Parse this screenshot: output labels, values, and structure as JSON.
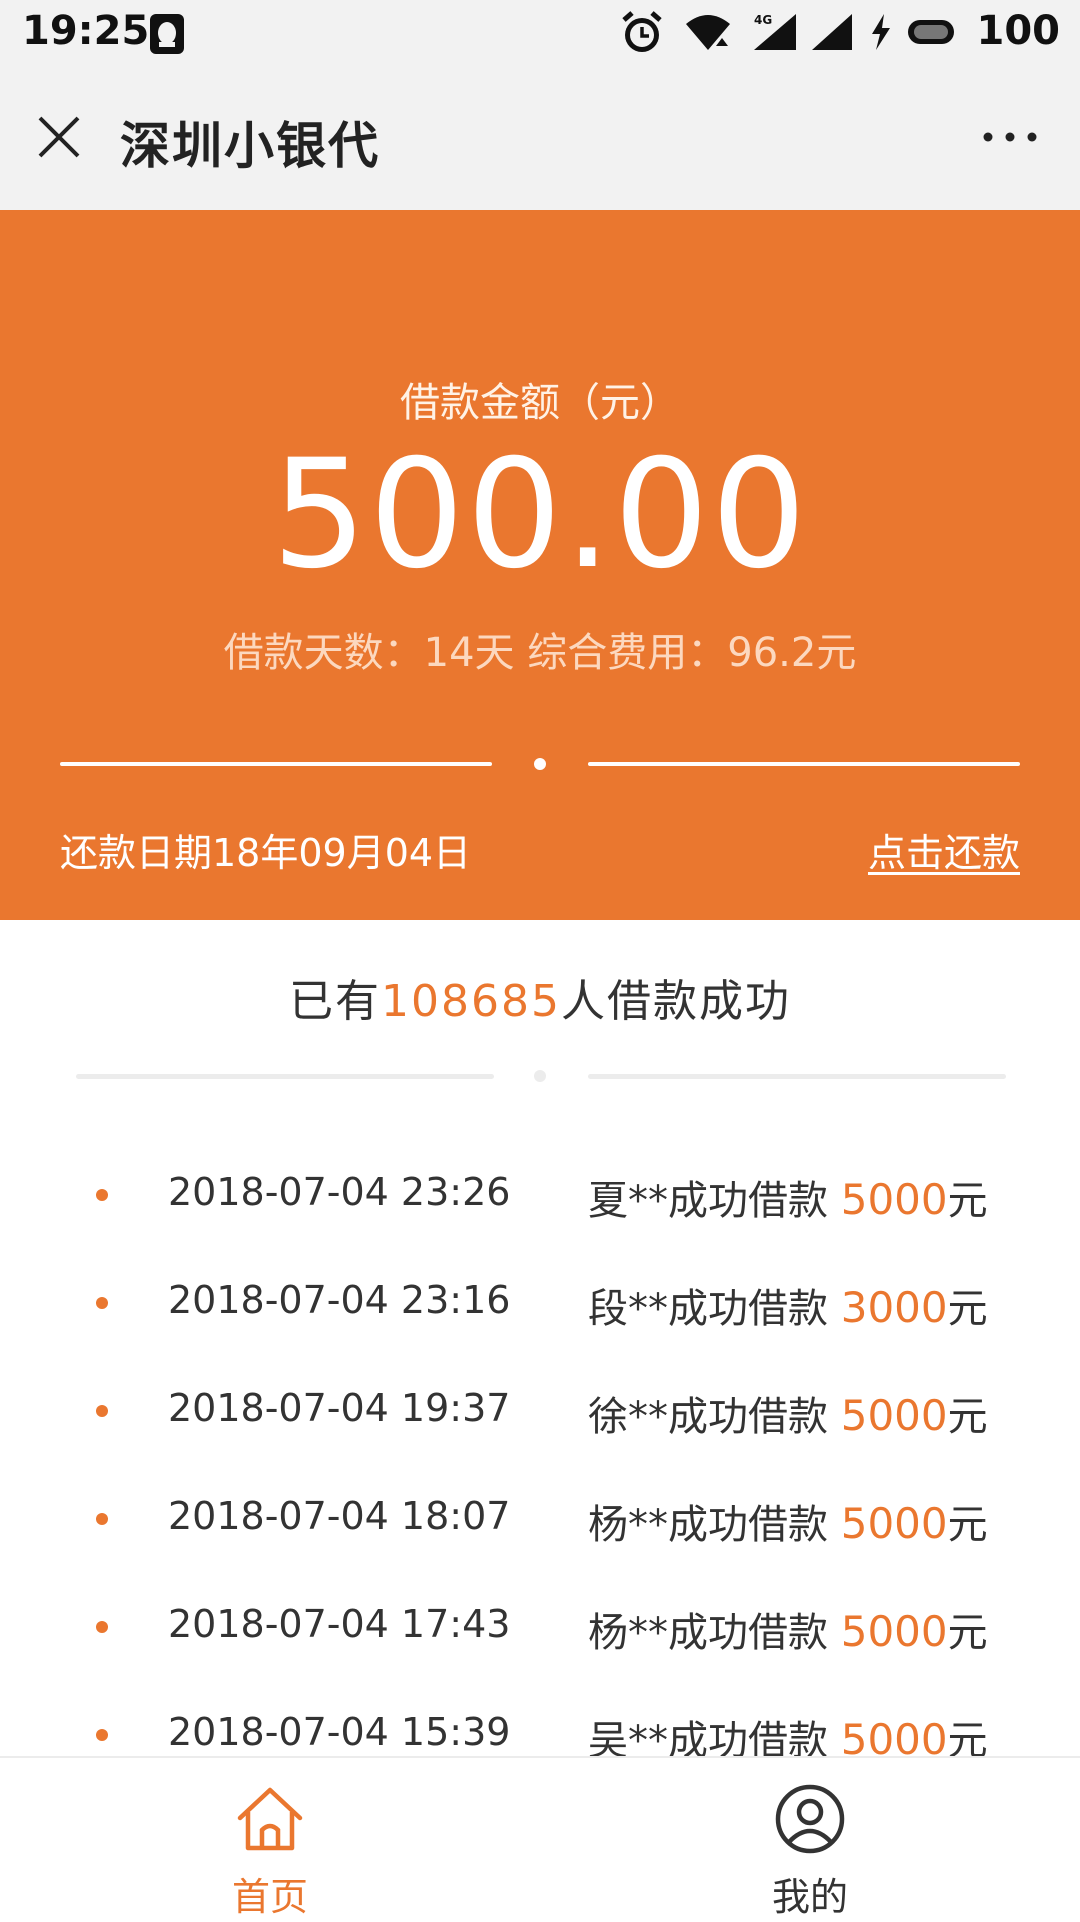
{
  "status_bar": {
    "time": "19:25",
    "network": "4G",
    "battery": "100",
    "icons": [
      "qq-icon",
      "alarm-icon",
      "wifi-icon",
      "signal-icon",
      "charging-icon",
      "battery-icon"
    ]
  },
  "nav": {
    "title": "深圳小银代",
    "icons": [
      "close-icon",
      "more-icon"
    ]
  },
  "hero": {
    "label": "借款金额（元）",
    "amount": "500.00",
    "meta": "借款天数：14天 综合费用：96.2元",
    "due_date": "还款日期18年09月04日",
    "repay_link": "点击还款",
    "color": "#ea772f"
  },
  "stats": {
    "prefix": "已有",
    "count": "108685",
    "suffix": "人借款成功"
  },
  "records": [
    {
      "time": "2018-07-04 23:26",
      "text": "夏**成功借款 ",
      "amount": "5000",
      "unit": "元"
    },
    {
      "time": "2018-07-04 23:16",
      "text": "段**成功借款 ",
      "amount": "3000",
      "unit": "元"
    },
    {
      "time": "2018-07-04 19:37",
      "text": "徐**成功借款 ",
      "amount": "5000",
      "unit": "元"
    },
    {
      "time": "2018-07-04 18:07",
      "text": "杨**成功借款 ",
      "amount": "5000",
      "unit": "元"
    },
    {
      "time": "2018-07-04 17:43",
      "text": "杨**成功借款 ",
      "amount": "5000",
      "unit": "元"
    },
    {
      "time": "2018-07-04 15:39",
      "text": "吴**成功借款 ",
      "amount": "5000",
      "unit": "元"
    }
  ],
  "tabbar": {
    "home": "首页",
    "mine": "我的",
    "active_color": "#ea772f",
    "icons": [
      "home-icon",
      "user-icon"
    ]
  }
}
